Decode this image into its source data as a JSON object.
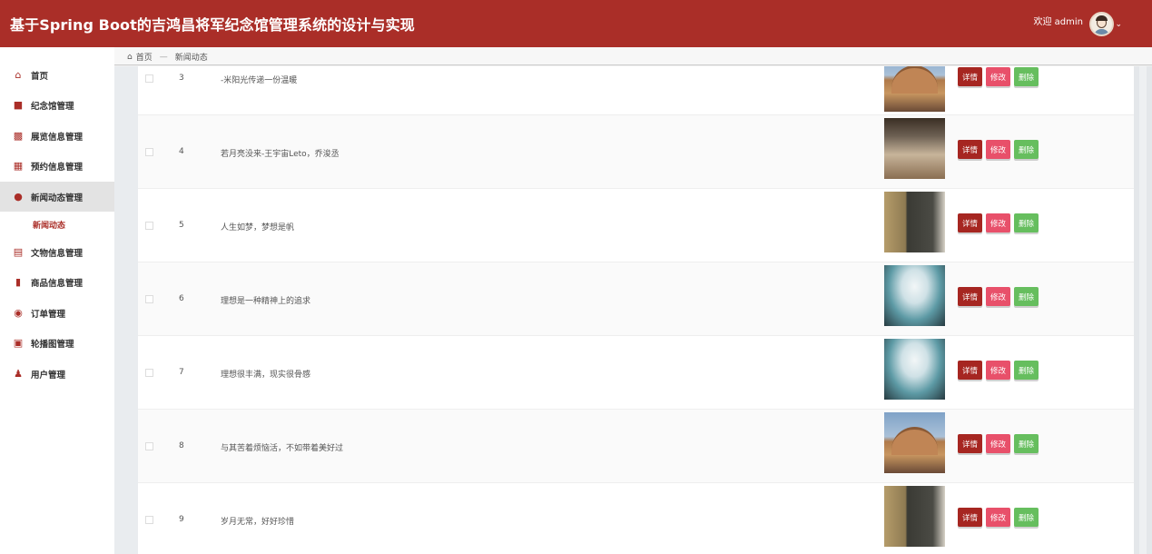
{
  "header": {
    "title": "基于Spring Boot的吉鸿昌将军纪念馆管理系统的设计与实现",
    "welcome": "欢迎 admin",
    "accent": "#aa2e28"
  },
  "sidebar": {
    "items": [
      {
        "label": "首页",
        "icon": "home-icon"
      },
      {
        "label": "纪念馆管理",
        "icon": "museum-icon"
      },
      {
        "label": "展览信息管理",
        "icon": "exhibit-icon"
      },
      {
        "label": "预约信息管理",
        "icon": "calendar-icon"
      },
      {
        "label": "新闻动态管理",
        "icon": "news-icon"
      },
      {
        "label": "文物信息管理",
        "icon": "artifact-icon"
      },
      {
        "label": "商品信息管理",
        "icon": "product-icon"
      },
      {
        "label": "订单管理",
        "icon": "order-icon"
      },
      {
        "label": "轮播图管理",
        "icon": "carousel-icon"
      },
      {
        "label": "用户管理",
        "icon": "user-icon"
      }
    ],
    "active_index": 4,
    "submenu_label": "新闻动态"
  },
  "breadcrumb": {
    "home": "首页",
    "current": "新闻动态"
  },
  "table": {
    "rows": [
      {
        "index": "3",
        "title": "-米阳光传递一份温暖",
        "image": "museum-exterior"
      },
      {
        "index": "4",
        "title": "若月亮没来-王宇宙Leto，乔浚丞",
        "image": "exhibition-hall"
      },
      {
        "index": "5",
        "title": "人生如梦，梦想是帆",
        "image": "modern-building"
      },
      {
        "index": "6",
        "title": "理想是一种精神上的追求",
        "image": "glass-dome-atrium"
      },
      {
        "index": "7",
        "title": "理想很丰满，现实很骨感",
        "image": "glass-dome-atrium"
      },
      {
        "index": "8",
        "title": "与其苦着烦恼活，不如带着美好过",
        "image": "museum-exterior"
      },
      {
        "index": "9",
        "title": "岁月无常，好好珍惜",
        "image": "modern-building"
      }
    ],
    "actions": {
      "detail": "详情",
      "edit": "修改",
      "delete": "删除"
    }
  }
}
